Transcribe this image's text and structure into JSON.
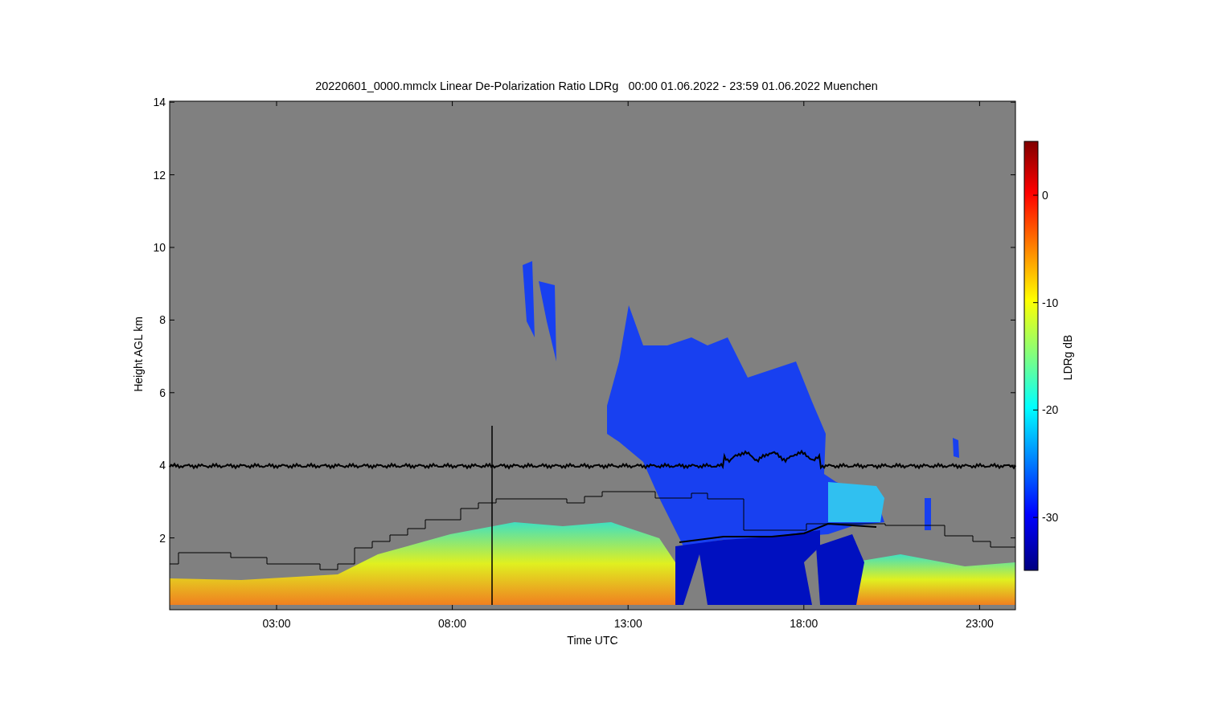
{
  "title": "20220601_0000.mmclx Linear De-Polarization Ratio LDRg   00:00 01.06.2022 - 23:59 01.06.2022 Muenchen",
  "plot": {
    "ylabel": "Height AGL km",
    "yticks": [
      "14",
      "12",
      "10",
      "8",
      "6",
      "4",
      "2"
    ],
    "xlabel": "Time UTC",
    "xticks": [
      "03:00",
      "08:00",
      "13:00",
      "18:00",
      "23:00"
    ]
  },
  "colorbar": {
    "label": "LDRg dB",
    "ticks": [
      "0",
      "-10",
      "-20",
      "-30"
    ]
  }
}
